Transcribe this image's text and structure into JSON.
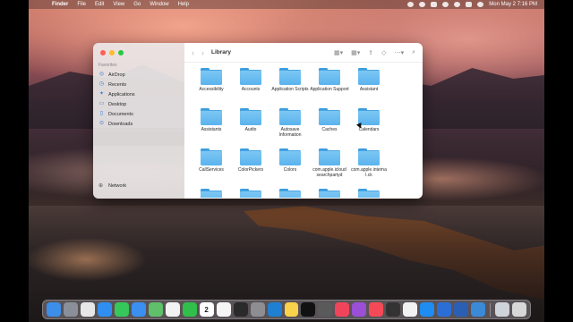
{
  "menubar": {
    "apple_icon": "apple-icon",
    "app_name": "Finder",
    "menus": [
      "File",
      "Edit",
      "View",
      "Go",
      "Window",
      "Help"
    ],
    "status_icons": [
      "camera-icon",
      "record-icon",
      "battery-icon",
      "wifi-icon",
      "search-icon",
      "control-center-icon",
      "siri-icon"
    ],
    "clock": "Mon May 2  7:16 PM"
  },
  "finder": {
    "title": "Library",
    "sidebar": {
      "section": "Favorites",
      "items": [
        {
          "label": "AirDrop",
          "icon": "airdrop-icon"
        },
        {
          "label": "Recents",
          "icon": "clock-icon"
        },
        {
          "label": "Applications",
          "icon": "applications-icon"
        },
        {
          "label": "Desktop",
          "icon": "desktop-icon"
        },
        {
          "label": "Documents",
          "icon": "document-icon"
        },
        {
          "label": "Downloads",
          "icon": "download-icon"
        }
      ],
      "network": "Network"
    },
    "folders": [
      "Accessibility",
      "Accounts",
      "Application Scripts",
      "Application Support",
      "Assistant",
      "Assistants",
      "Audio",
      "Autosave Information",
      "Caches",
      "Calendars",
      "CallServices",
      "ColorPickers",
      "Colors",
      "com.apple.icloud searchpartyd",
      "com.apple.interna l.ck"
    ]
  },
  "dock": {
    "apps": [
      {
        "name": "finder-icon",
        "color": "#3c8ee8"
      },
      {
        "name": "launchpad-icon",
        "color": "#8a8f9a"
      },
      {
        "name": "chrome-icon",
        "color": "#e7e7e7"
      },
      {
        "name": "safari-icon",
        "color": "#2f8ef0"
      },
      {
        "name": "messages-icon",
        "color": "#35c759"
      },
      {
        "name": "mail-icon",
        "color": "#3a8ff0"
      },
      {
        "name": "maps-icon",
        "color": "#5fbf6a"
      },
      {
        "name": "photos-icon",
        "color": "#f2f2f2"
      },
      {
        "name": "facetime-icon",
        "color": "#2fbf4a"
      },
      {
        "name": "calendar-icon",
        "color": "#ffffff"
      },
      {
        "name": "notes-icon",
        "color": "#f5f5f5"
      },
      {
        "name": "terminal-icon",
        "color": "#2a2a2a"
      },
      {
        "name": "settings-icon",
        "color": "#8d8d92"
      },
      {
        "name": "vscode-icon",
        "color": "#1f7fd1"
      },
      {
        "name": "notes2-icon",
        "color": "#f7d24a"
      },
      {
        "name": "appletv-icon",
        "color": "#111111"
      },
      {
        "name": "calculator-icon",
        "color": "#5a5a5a"
      },
      {
        "name": "music-icon",
        "color": "#f0445a"
      },
      {
        "name": "podcasts-icon",
        "color": "#9a4fd6"
      },
      {
        "name": "news-icon",
        "color": "#f44a57"
      },
      {
        "name": "tv-icon",
        "color": "#333333"
      },
      {
        "name": "reminders-icon",
        "color": "#f2f2f2"
      },
      {
        "name": "appstore-icon",
        "color": "#1e8cf0"
      },
      {
        "name": "xcode-icon",
        "color": "#2b6fd6"
      },
      {
        "name": "word-icon",
        "color": "#2b5fb4"
      },
      {
        "name": "preview-icon",
        "color": "#3b8ad8"
      },
      {
        "name": "downloads-stack-icon",
        "color": "#cfd3da"
      },
      {
        "name": "trash-icon",
        "color": "#d7d7d7"
      }
    ],
    "calendar_day": "2"
  }
}
